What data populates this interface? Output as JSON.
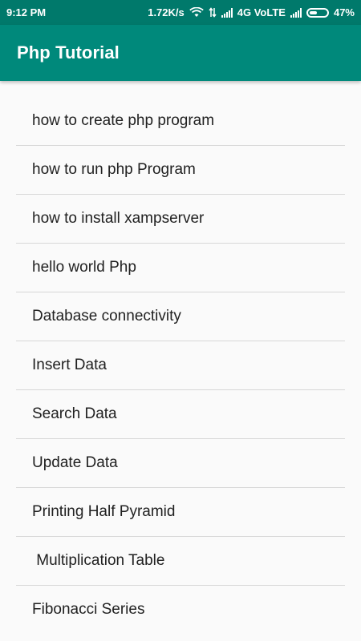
{
  "status_bar": {
    "time": "9:12 PM",
    "network_speed": "1.72K/s",
    "network_type": "4G VoLTE",
    "battery_percent": "47%",
    "battery_level": 0.47,
    "icons": [
      "wifi-icon",
      "data-transfer-icon",
      "signal-icon",
      "signal-icon",
      "battery-icon"
    ]
  },
  "app_bar": {
    "title": "Php Tutorial",
    "background_color": "#00897b",
    "status_bar_color": "#00796b"
  },
  "list": {
    "items": [
      {
        "label": "how to create php program"
      },
      {
        "label": "how to run php Program"
      },
      {
        "label": "how to install xampserver"
      },
      {
        "label": "hello world Php"
      },
      {
        "label": "Database connectivity"
      },
      {
        "label": "Insert Data"
      },
      {
        "label": "Search Data"
      },
      {
        "label": "Update Data"
      },
      {
        "label": "Printing Half Pyramid"
      },
      {
        "label": " Multiplication Table"
      },
      {
        "label": "Fibonacci Series"
      }
    ]
  }
}
